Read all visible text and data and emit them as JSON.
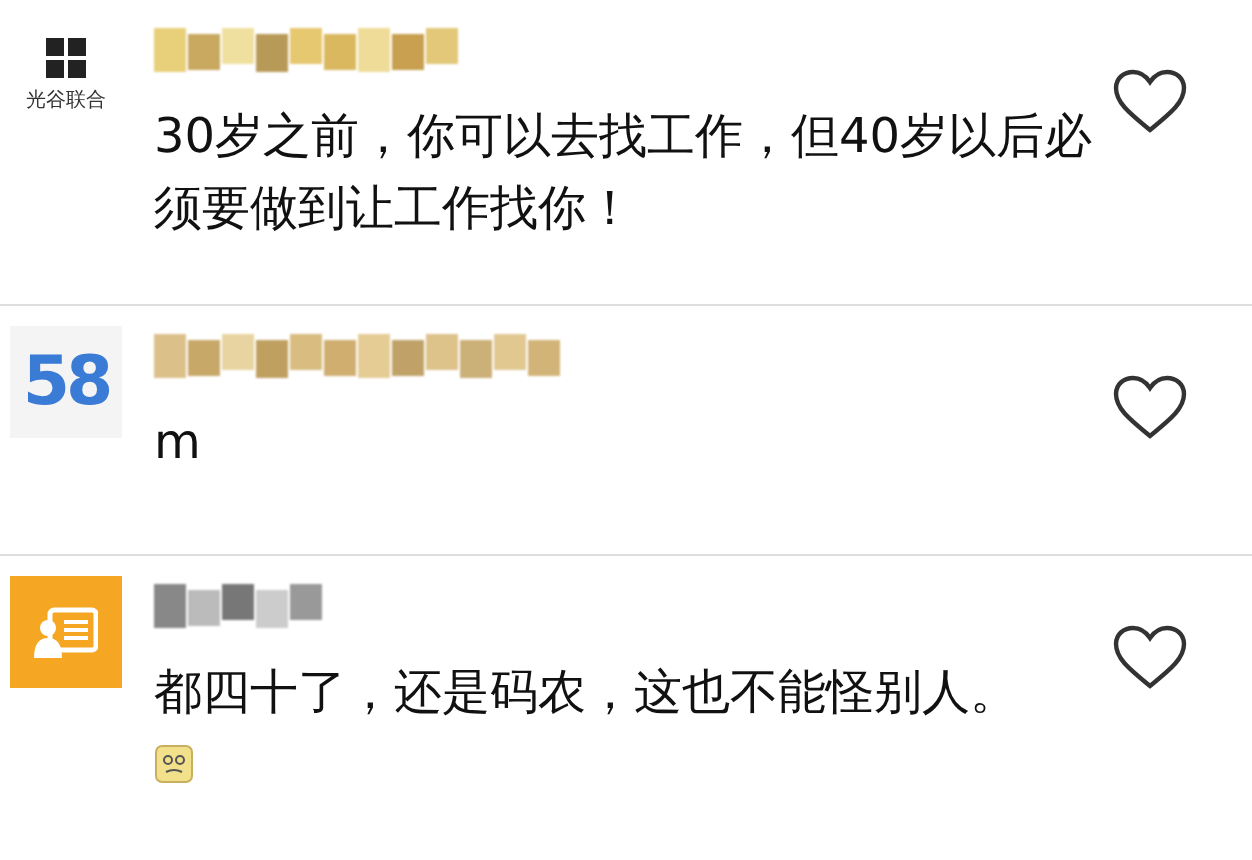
{
  "comments": [
    {
      "avatar": {
        "kind": "brand-mark",
        "caption": "光谷联合"
      },
      "text": "30岁之前，你可以去找工作，但40岁以后必须要做到让工作找你！",
      "emoji": false,
      "liked": false
    },
    {
      "avatar": {
        "kind": "number-logo",
        "caption": "58"
      },
      "text": "m",
      "emoji": false,
      "liked": false
    },
    {
      "avatar": {
        "kind": "card-icon"
      },
      "text": "都四十了，还是码农，这也不能怪别人。",
      "emoji": true,
      "liked": false
    }
  ]
}
